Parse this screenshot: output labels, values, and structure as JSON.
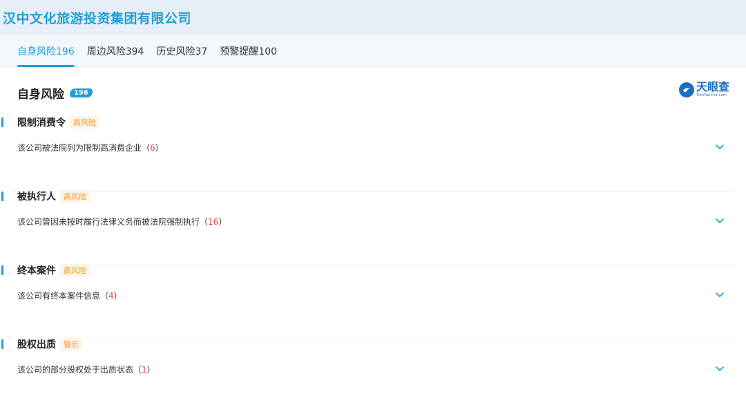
{
  "header": {
    "company_name": "汉中文化旅游投资集团有限公司"
  },
  "tabs": [
    {
      "label": "自身风险196",
      "active": true
    },
    {
      "label": "周边风险394"
    },
    {
      "label": "历史风险37"
    },
    {
      "label": "预警提醒100"
    }
  ],
  "section": {
    "title": "自身风险",
    "count": "196"
  },
  "brand": {
    "name": "天眼查",
    "sub": "TianYanCha.com"
  },
  "risks": [
    {
      "name": "限制消费令",
      "tag": "高风险",
      "desc": "该公司被法院列为限制高消费企业",
      "count": "6"
    },
    {
      "name": "被执行人",
      "tag": "高风险",
      "desc": "该公司曾因未按时履行法律义务而被法院强制执行",
      "count": "16"
    },
    {
      "name": "终本案件",
      "tag": "高风险",
      "desc": "该公司有终本案件信息",
      "count": "4"
    },
    {
      "name": "股权出质",
      "tag": "警示",
      "desc": "该公司的部分股权处于出质状态",
      "count": "1"
    }
  ],
  "punct": {
    "open": "（",
    "close": "）"
  },
  "colors": {
    "accent": "#1c9fd8",
    "tag_bg": "#fff4e6",
    "tag_text": "#f39c2c",
    "count": "#d84a2c"
  }
}
